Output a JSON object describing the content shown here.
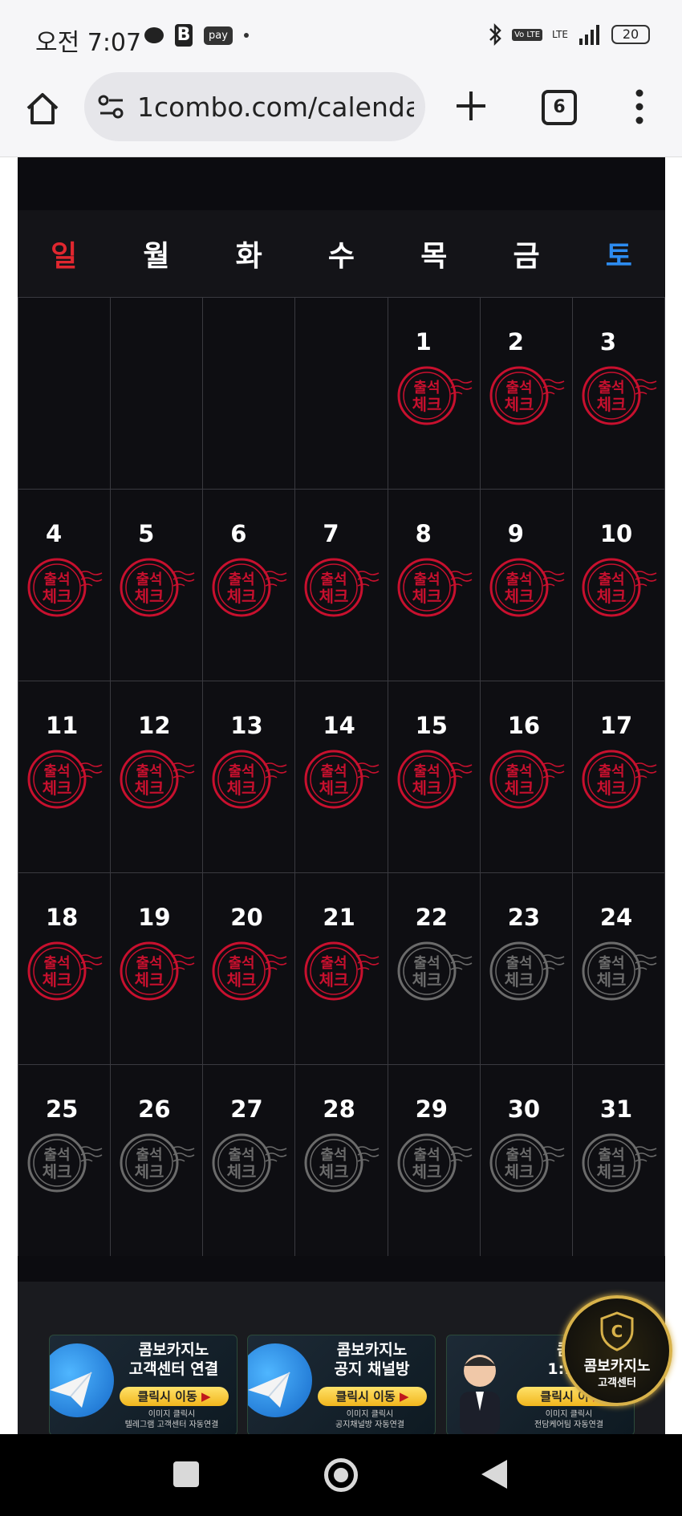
{
  "status_bar": {
    "time": "오전 7:07",
    "pay_label": "pay",
    "network": "LTE",
    "volte": "Vo LTE",
    "battery": "20"
  },
  "browser": {
    "url": "1combo.com/calenda",
    "tab_count": "6"
  },
  "calendar": {
    "weekdays": [
      "일",
      "월",
      "화",
      "수",
      "목",
      "금",
      "토"
    ],
    "weekday_colors": {
      "sunday": "#e0272f",
      "saturday": "#2d8cf0",
      "weekday": "#ffffff"
    },
    "stamp_text_line1": "출석",
    "stamp_text_line2": "체크",
    "stamp_colors": {
      "checked": "#c8102e",
      "unchecked": "#6b6b6b"
    },
    "leading_blank_days": 4,
    "days": [
      {
        "n": "1",
        "checked": true
      },
      {
        "n": "2",
        "checked": true
      },
      {
        "n": "3",
        "checked": true
      },
      {
        "n": "4",
        "checked": true
      },
      {
        "n": "5",
        "checked": true
      },
      {
        "n": "6",
        "checked": true
      },
      {
        "n": "7",
        "checked": true
      },
      {
        "n": "8",
        "checked": true
      },
      {
        "n": "9",
        "checked": true
      },
      {
        "n": "10",
        "checked": true
      },
      {
        "n": "11",
        "checked": true
      },
      {
        "n": "12",
        "checked": true
      },
      {
        "n": "13",
        "checked": true
      },
      {
        "n": "14",
        "checked": true
      },
      {
        "n": "15",
        "checked": true
      },
      {
        "n": "16",
        "checked": true
      },
      {
        "n": "17",
        "checked": true
      },
      {
        "n": "18",
        "checked": true
      },
      {
        "n": "19",
        "checked": true
      },
      {
        "n": "20",
        "checked": true
      },
      {
        "n": "21",
        "checked": true
      },
      {
        "n": "22",
        "checked": false
      },
      {
        "n": "23",
        "checked": false
      },
      {
        "n": "24",
        "checked": false
      },
      {
        "n": "25",
        "checked": false
      },
      {
        "n": "26",
        "checked": false
      },
      {
        "n": "27",
        "checked": false
      },
      {
        "n": "28",
        "checked": false
      },
      {
        "n": "29",
        "checked": false
      },
      {
        "n": "30",
        "checked": false
      },
      {
        "n": "31",
        "checked": false
      }
    ]
  },
  "ads": [
    {
      "title1": "콤보카지노",
      "title2": "고객센터 연결",
      "button": "클릭시 이동",
      "sub1": "이미지 클릭시",
      "sub2": "텔레그램 고객센터 자동연결"
    },
    {
      "title1": "콤보카지노",
      "title2": "공지 채널방",
      "button": "클릭시 이동",
      "sub1": "이미지 클릭시",
      "sub2": "공지채널방 자동연결"
    },
    {
      "title1": "콤보",
      "title2": "1:1 전",
      "button": "클릭시 이",
      "sub1": "이미지 클릭시",
      "sub2": "전담케어팀 자동연결"
    }
  ],
  "support_badge": {
    "line1": "콤보카지노",
    "line2": "고객센터"
  }
}
